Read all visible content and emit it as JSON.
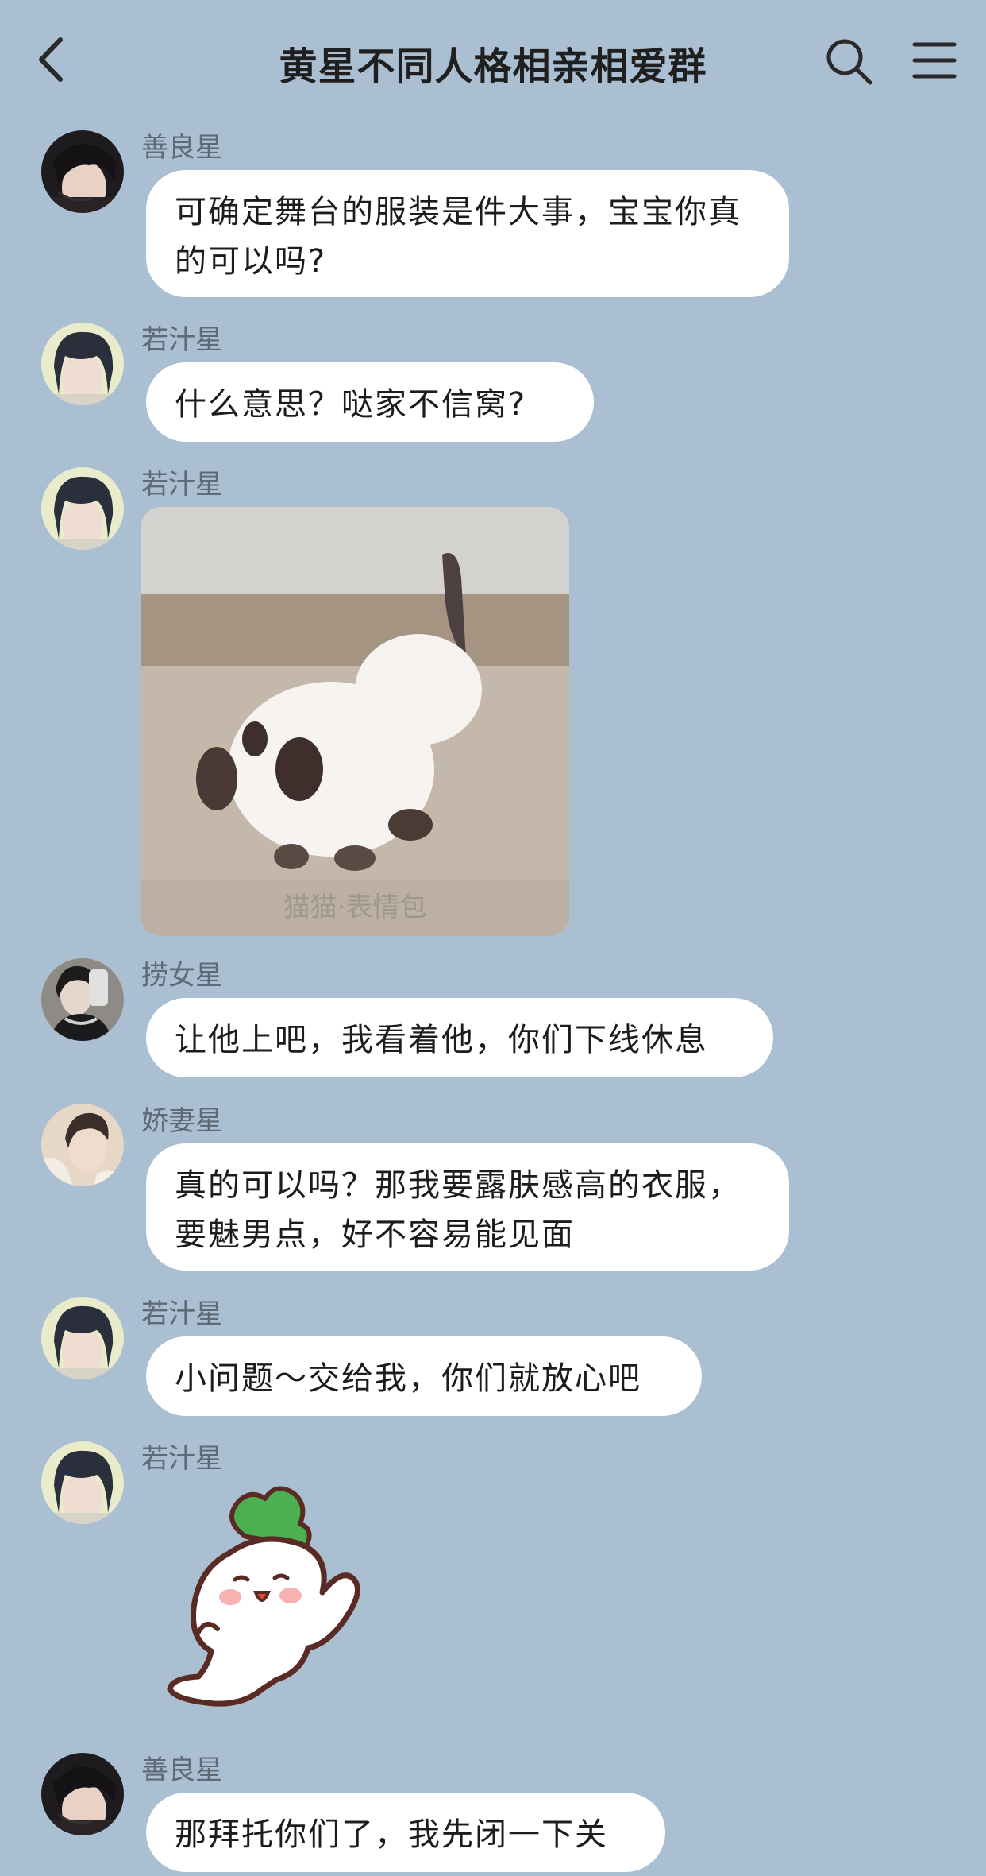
{
  "header": {
    "title": "黄星不同人格相亲相爱群"
  },
  "messages": [
    {
      "sender": "善良星",
      "type": "text",
      "text": "可确定舞台的服装是件大事，宝宝你真的可以吗?"
    },
    {
      "sender": "若汁星",
      "type": "text",
      "text": "什么意思？哒家不信窝?"
    },
    {
      "sender": "若汁星",
      "type": "image",
      "image_text": "猫猫·表情包"
    },
    {
      "sender": "捞女星",
      "type": "text",
      "text": "让他上吧，我看着他，你们下线休息"
    },
    {
      "sender": "娇妻星",
      "type": "text",
      "text": "真的可以吗？那我要露肤感高的衣服，要魅男点，好不容易能见面"
    },
    {
      "sender": "若汁星",
      "type": "text",
      "text": "小问题～交给我，你们就放心吧"
    },
    {
      "sender": "若汁星",
      "type": "sticker",
      "sticker": "radish-sticker"
    },
    {
      "sender": "善良星",
      "type": "text",
      "text": "那拜托你们了，我先闭一下关"
    }
  ],
  "colors": {
    "background": "#abbfd2",
    "bubble": "#ffffff",
    "sender_text": "#5e6a76",
    "message_text": "#1c1c1c"
  }
}
